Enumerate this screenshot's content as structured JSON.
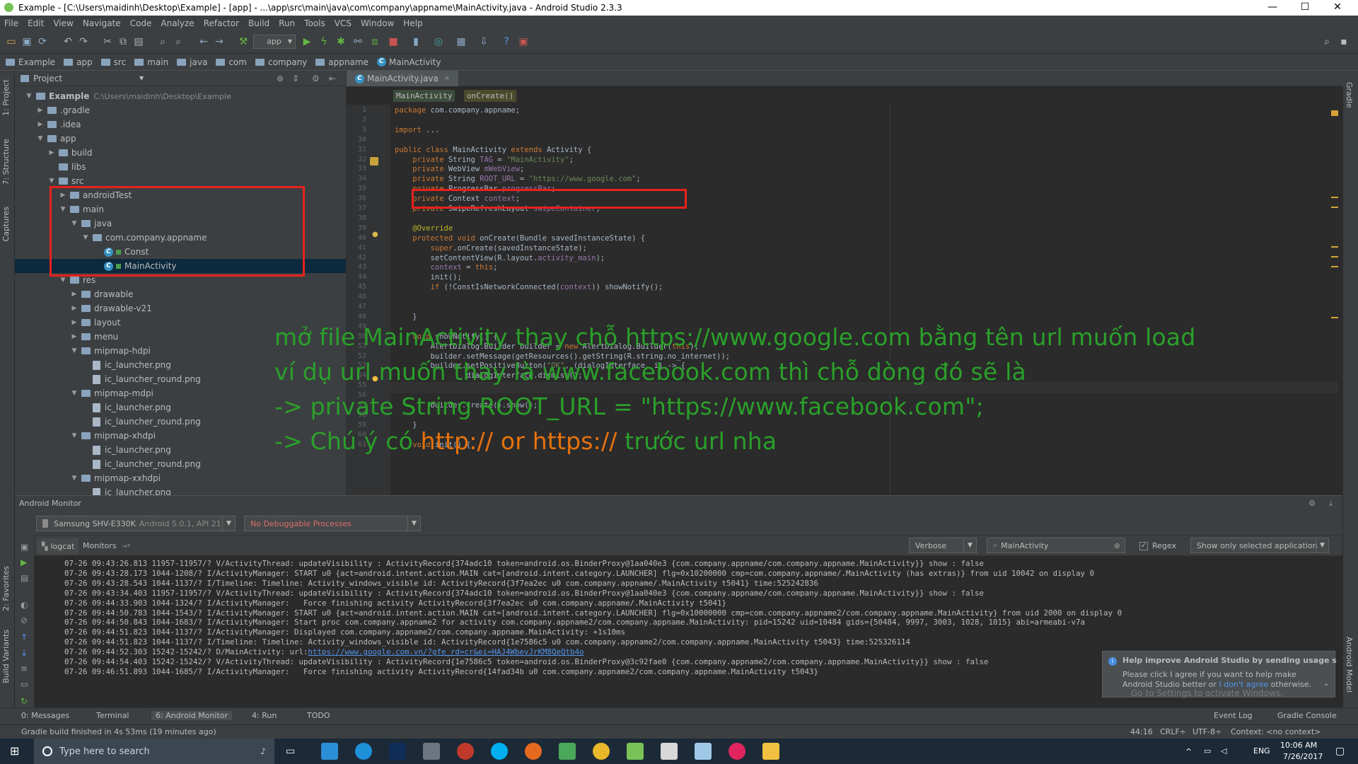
{
  "window": {
    "title": "Example - [C:\\Users\\maidinh\\Desktop\\Example] - [app] - ...\\app\\src\\main\\java\\com\\company\\appname\\MainActivity.java - Android Studio 2.3.3",
    "min": "—",
    "max": "☐",
    "close": "✕"
  },
  "menu": [
    "File",
    "Edit",
    "View",
    "Navigate",
    "Code",
    "Analyze",
    "Refactor",
    "Build",
    "Run",
    "Tools",
    "VCS",
    "Window",
    "Help"
  ],
  "toolbar": {
    "run_config": "app"
  },
  "breadcrumb": [
    "Example",
    "app",
    "src",
    "main",
    "java",
    "com",
    "company",
    "appname",
    "MainActivity"
  ],
  "left_tabs": [
    "1: Project",
    "7: Structure",
    "Captures",
    "2: Favorites",
    "Build Variants"
  ],
  "right_tabs": [
    "Gradle",
    "Android Model"
  ],
  "project": {
    "view_label": "Project",
    "root_name": "Example",
    "root_path": "C:\\Users\\maidinh\\Desktop\\Example",
    "tree": [
      {
        "label": ".gradle",
        "arrow": "▶"
      },
      {
        "label": ".idea",
        "arrow": "▶"
      },
      {
        "label": "app",
        "arrow": "▼"
      },
      {
        "label": "build",
        "arrow": "▶"
      },
      {
        "label": "libs",
        "arrow": ""
      },
      {
        "label": "src",
        "arrow": "▼"
      },
      {
        "label": "androidTest",
        "arrow": "▶"
      },
      {
        "label": "main",
        "arrow": "▼"
      },
      {
        "label": "java",
        "arrow": "▼"
      },
      {
        "label": "com.company.appname",
        "arrow": "▼"
      },
      {
        "label": "Const",
        "arrow": ""
      },
      {
        "label": "MainActivity",
        "arrow": ""
      },
      {
        "label": "res",
        "arrow": "▼"
      },
      {
        "label": "drawable",
        "arrow": "▶"
      },
      {
        "label": "drawable-v21",
        "arrow": "▶"
      },
      {
        "label": "layout",
        "arrow": "▶"
      },
      {
        "label": "menu",
        "arrow": "▶"
      },
      {
        "label": "mipmap-hdpi",
        "arrow": "▼"
      },
      {
        "label": "ic_launcher.png",
        "arrow": ""
      },
      {
        "label": "ic_launcher_round.png",
        "arrow": ""
      },
      {
        "label": "mipmap-mdpi",
        "arrow": "▼"
      },
      {
        "label": "ic_launcher.png",
        "arrow": ""
      },
      {
        "label": "ic_launcher_round.png",
        "arrow": ""
      },
      {
        "label": "mipmap-xhdpi",
        "arrow": "▼"
      },
      {
        "label": "ic_launcher.png",
        "arrow": ""
      },
      {
        "label": "ic_launcher_round.png",
        "arrow": ""
      },
      {
        "label": "mipmap-xxhdpi",
        "arrow": "▼"
      },
      {
        "label": "ic_launcher.png",
        "arrow": ""
      }
    ]
  },
  "editor": {
    "tab": "MainActivity.java",
    "crumbs": [
      "MainActivity",
      "onCreate()"
    ],
    "lines": [
      {
        "n": "1",
        "code": "package com.company.appname;"
      },
      {
        "n": "2",
        "code": ""
      },
      {
        "n": "3",
        "code": "import ..."
      },
      {
        "n": "30",
        "code": ""
      },
      {
        "n": "31",
        "code": "public class MainActivity extends Activity {"
      },
      {
        "n": "32",
        "code": "    private String TAG = \"MainActivity\";"
      },
      {
        "n": "33",
        "code": "    private WebView mWebView;"
      },
      {
        "n": "34",
        "code": "    private String ROOT_URL = \"https://www.google.com\";"
      },
      {
        "n": "35",
        "code": "    private ProgressBar progressBar;"
      },
      {
        "n": "36",
        "code": "    private Context context;"
      },
      {
        "n": "37",
        "code": "    private SwipeRefreshLayout swipeContainer;"
      },
      {
        "n": "38",
        "code": ""
      },
      {
        "n": "39",
        "code": "    @Override"
      },
      {
        "n": "40",
        "code": "    protected void onCreate(Bundle savedInstanceState) {"
      },
      {
        "n": "41",
        "code": "        super.onCreate(savedInstanceState);"
      },
      {
        "n": "42",
        "code": "        setContentView(R.layout.activity_main);"
      },
      {
        "n": "43",
        "code": "        context = this;"
      },
      {
        "n": "44",
        "code": "        init();"
      },
      {
        "n": "45",
        "code": "        if (!ConstIsNetworkConnected(context)) showNotify();"
      },
      {
        "n": "46",
        "code": ""
      },
      {
        "n": "47",
        "code": ""
      },
      {
        "n": "48",
        "code": "    }"
      },
      {
        "n": "49",
        "code": ""
      },
      {
        "n": "50",
        "code": "    void showNotify() {"
      },
      {
        "n": "51",
        "code": "        AlertDialog.Builder builder = new AlertDialog.Builder(this);"
      },
      {
        "n": "52",
        "code": "        builder.setMessage(getResources().getString(R.string.no_internet));"
      },
      {
        "n": "53",
        "code": "        builder.setPositiveButton(\"OK\", (dialogInterface, i) -> {"
      },
      {
        "n": "54",
        "code": "                dialogInterface.dismiss();"
      },
      {
        "n": "55",
        "code": ""
      },
      {
        "n": "56",
        "code": ""
      },
      {
        "n": "57",
        "code": "        builder.create().show();"
      },
      {
        "n": "58",
        "code": ""
      },
      {
        "n": "59",
        "code": "    }"
      },
      {
        "n": "60",
        "code": ""
      },
      {
        "n": "61",
        "code": "    void init() {"
      }
    ]
  },
  "overlay": {
    "l1": "mở file MainActivity thay chỗ https://www.google.com bằng tên url muốn load",
    "l2": "ví dụ url muốn thay là www.facebook.com thì chỗ dòng đó sẽ là",
    "l3": "-> private String ROOT_URL = \"https://www.facebook.com\";",
    "l4a": "-> Chú ý có ",
    "l4b": "http:// or https://",
    "l4c": " trước url nha"
  },
  "monitor": {
    "title": "Android Monitor",
    "device": "Samsung SHV-E330K",
    "device_os": "Android 5.0.1, API 21",
    "process": "No Debuggable Processes",
    "tab_logcat": "logcat",
    "tab_monitors": "Monitors",
    "level": "Verbose",
    "search": "MainActivity",
    "regex": "Regex",
    "filter": "Show only selected application",
    "log": [
      {
        "t": "07-26 09:43:26.813 11957-11957/? V/ActivityThread: updateVisibility : ActivityRecord{374adc10 token=android.os.BinderProxy@1aa040e3 {com.company.appname/com.company.appname.MainActivity}} show : false",
        "link": ""
      },
      {
        "t": "07-26 09:43:28.173 1044-1208/? I/ActivityManager: START u0 {act=android.intent.action.MAIN cat=[android.intent.category.LAUNCHER] flg=0x10200000 cmp=com.company.appname/.MainActivity (has extras)} from uid 10042 on display 0",
        "link": ""
      },
      {
        "t": "07-26 09:43:28.543 1044-1137/? I/Timeline: Timeline: Activity_windows_visible id: ActivityRecord{3f7ea2ec u0 com.company.appname/.MainActivity t5041} time:525242836",
        "link": ""
      },
      {
        "t": "07-26 09:43:34.403 11957-11957/? V/ActivityThread: updateVisibility : ActivityRecord{374adc10 token=android.os.BinderProxy@1aa040e3 {com.company.appname/com.company.appname.MainActivity}} show : false",
        "link": ""
      },
      {
        "t": "07-26 09:44:33.903 1044-1324/? I/ActivityManager:   Force finishing activity ActivityRecord{3f7ea2ec u0 com.company.appname/.MainActivity t5041}",
        "link": ""
      },
      {
        "t": "07-26 09:44:50.783 1044-1543/? I/ActivityManager: START u0 {act=android.intent.action.MAIN cat=[android.intent.category.LAUNCHER] flg=0x10000000 cmp=com.company.appname2/com.company.appname.MainActivity} from uid 2000 on display 0",
        "link": ""
      },
      {
        "t": "07-26 09:44:50.843 1044-1683/? I/ActivityManager: Start proc com.company.appname2 for activity com.company.appname2/com.company.appname.MainActivity: pid=15242 uid=10484 gids={50484, 9997, 3003, 1028, 1015} abi=armeabi-v7a",
        "link": ""
      },
      {
        "t": "07-26 09:44:51.823 1044-1137/? I/ActivityManager: Displayed com.company.appname2/com.company.appname.MainActivity: +1s10ms",
        "link": ""
      },
      {
        "t": "07-26 09:44:51.823 1044-1137/? I/Timeline: Timeline: Activity_windows_visible id: ActivityRecord{1e7586c5 u0 com.company.appname2/com.company.appname.MainActivity t5043} time:525326114",
        "link": ""
      },
      {
        "t": "07-26 09:44:52.303 15242-15242/? D/MainActivity: url:",
        "link": "https://www.google.com.vn/?gfe_rd=cr&ei=HAJ4WbevJrKM8QeQtb4o"
      },
      {
        "t": "07-26 09:44:54.403 15242-15242/? V/ActivityThread: updateVisibility : ActivityRecord{1e7586c5 token=android.os.BinderProxy@3c92fae0 {com.company.appname2/com.company.appname.MainActivity}} show : false",
        "link": ""
      },
      {
        "t": "07-26 09:46:51.893 1044-1685/? I/ActivityManager:   Force finishing activity ActivityRecord{14fad34b u0 com.company.appname2/com.company.appname.MainActivity t5043}",
        "link": ""
      }
    ]
  },
  "notification": {
    "title": "Help improve Android Studio by sending usage s",
    "l1": "Please click I agree if you want to help make",
    "l2a": "Android Studio better or ",
    "l2b": "I don't agree",
    "l2c": " otherwise.",
    "watermark": "Go to Settings to activate Windows."
  },
  "bottom_tabs": {
    "messages": "0: Messages",
    "terminal": "Terminal",
    "monitor": "6: Android Monitor",
    "run": "4: Run",
    "todo": "TODO",
    "event_log": "Event Log",
    "gradle_console": "Gradle Console"
  },
  "status": {
    "message": "Gradle build finished in 4s 53ms (19 minutes ago)",
    "pos": "44:16",
    "crlf": "CRLF÷",
    "enc": "UTF-8÷",
    "context": "Context: <no context>"
  },
  "taskbar": {
    "search": "Type here to search",
    "lang": "ENG",
    "time": "10:06 AM",
    "date": "7/26/2017"
  }
}
